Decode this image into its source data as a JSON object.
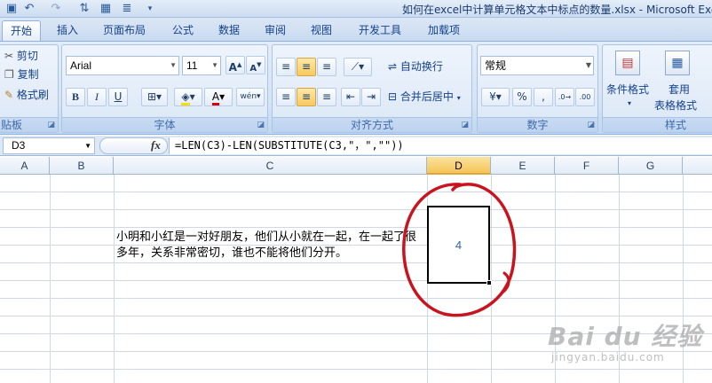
{
  "window": {
    "title": "如何在excel中计算单元格文本中标点的数量.xlsx - Microsoft Exc"
  },
  "quick_access": {
    "save_icon": "save-icon",
    "undo_icon": "undo-icon",
    "redo_icon": "redo-icon"
  },
  "tabs": [
    {
      "label": "开始",
      "active": true
    },
    {
      "label": "插入"
    },
    {
      "label": "页面布局"
    },
    {
      "label": "公式"
    },
    {
      "label": "数据"
    },
    {
      "label": "审阅"
    },
    {
      "label": "视图"
    },
    {
      "label": "开发工具"
    },
    {
      "label": "加载项"
    }
  ],
  "clipboard": {
    "cut": "剪切",
    "copy": "复制",
    "format_painter": "格式刷",
    "group": "贴板"
  },
  "font": {
    "name": "Arial",
    "size": "11",
    "bold": "B",
    "italic": "I",
    "underline": "U",
    "group": "字体"
  },
  "alignment": {
    "wrap_text": "自动换行",
    "merge_center": "合并后居中",
    "group": "对齐方式"
  },
  "number": {
    "format": "常规",
    "percent": "%",
    "comma": ",",
    "group": "数字"
  },
  "styles": {
    "conditional": "条件格式",
    "table_format_line1": "套用",
    "table_format_line2": "表格格式",
    "group": "样式"
  },
  "formula_bar": {
    "cell_ref": "D3",
    "fx": "fx",
    "formula": "=LEN(C3)-LEN(SUBSTITUTE(C3,\"，\",\"\"))"
  },
  "columns": [
    "A",
    "B",
    "C",
    "D",
    "E",
    "F",
    "G"
  ],
  "cells": {
    "C3": "小明和小红是一对好朋友，他们从小就在一起，在一起了很多年，关系非常密切，谁也不能将他们分开。",
    "D3": "4"
  },
  "watermark": {
    "main": "Bai du 经验",
    "url": "jingyan.baidu.com"
  },
  "colors": {
    "ribbon": "#dbe7f6",
    "selected_header": "#f5c556",
    "annotation": "#c8141e",
    "value": "#2d67b0"
  }
}
